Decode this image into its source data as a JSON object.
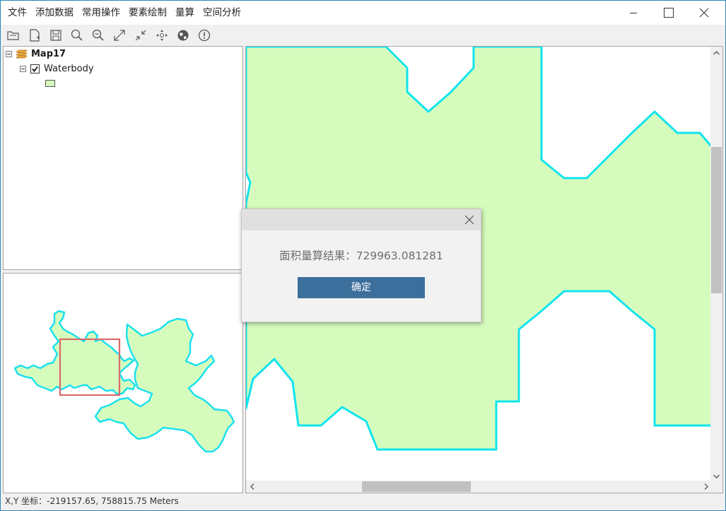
{
  "menu": [
    "文件",
    "添加数据",
    "常用操作",
    "要素绘制",
    "量算",
    "空间分析"
  ],
  "window_controls": [
    "minimize-icon",
    "maximize-icon",
    "close-icon"
  ],
  "toolbar": [
    "open-project-icon",
    "new-document-icon",
    "save-icon",
    "zoom-in-icon",
    "zoom-out-icon",
    "full-extent-icon",
    "shrink-extent-icon",
    "pan-icon",
    "globe-icon",
    "info-icon"
  ],
  "toc": {
    "map_name": "Map17",
    "layer_name": "Waterbody",
    "layer_checked": true,
    "fill_color": "#d6fcbd",
    "outline_color": "#00e5e5"
  },
  "overview": {
    "extent_color": "#d9534f"
  },
  "dialog": {
    "message": "面积量算结果：729963.081281",
    "ok_label": "确定"
  },
  "status": {
    "text": "X,Y 坐标：-219157.65, 758815.75  Meters"
  }
}
